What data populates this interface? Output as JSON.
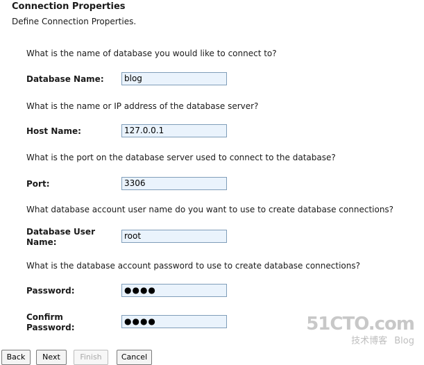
{
  "header": {
    "title": "Connection Properties",
    "subtitle": "Define Connection Properties."
  },
  "form": {
    "db_name": {
      "question": "What is the name of database you would like to connect to?",
      "label": "Database Name:",
      "value": "blog"
    },
    "host": {
      "question": "What is the name or IP address of the database server?",
      "label": "Host Name:",
      "value": "127.0.0.1"
    },
    "port": {
      "question": "What is the port on the database server used to connect to the database?",
      "label": "Port:",
      "value": "3306"
    },
    "user": {
      "question": "What database account user name do you want to use to create database connections?",
      "label": "Database User Name:",
      "value": "root"
    },
    "password": {
      "question": "What is the database account password to use to create database connections?",
      "label": "Password:",
      "value": "●●●●"
    },
    "confirm": {
      "label": "Confirm Password:",
      "value": "●●●●"
    }
  },
  "buttons": {
    "back": "Back",
    "next": "Next",
    "finish": "Finish",
    "cancel": "Cancel"
  },
  "watermark": {
    "site": "51CTO.com",
    "tagline": "技术博客",
    "blog": "Blog"
  }
}
